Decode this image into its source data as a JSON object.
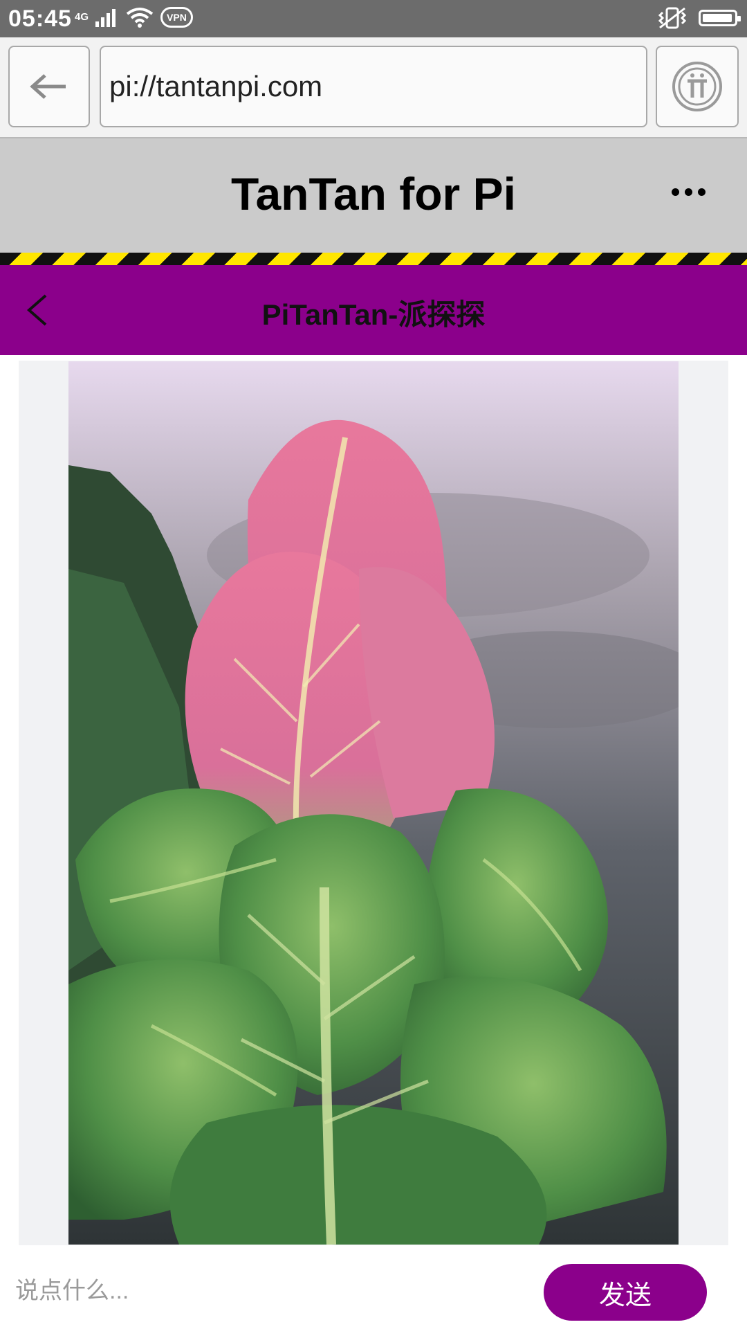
{
  "status_bar": {
    "time": "05:45",
    "network": "4G",
    "vpn": "VPN",
    "battery_level": 0.95
  },
  "browser": {
    "url": "pi://tantanpi.com",
    "back_icon": "arrow-left-icon",
    "pi_icon": "pi-logo-icon"
  },
  "app": {
    "title": "TanTan for Pi",
    "menu_icon": "more-dots-icon"
  },
  "nav": {
    "title": "PiTanTan-派探探",
    "back_icon": "chevron-left-icon",
    "color": "#8b008b"
  },
  "post": {
    "image": "pink-and-green-cabbage-photo"
  },
  "composer": {
    "placeholder": "说点什么...",
    "send_label": "发送"
  },
  "colors": {
    "accent": "#8b008b",
    "header_bg": "#cbcbcb",
    "hazard_yellow": "#ffe600"
  }
}
